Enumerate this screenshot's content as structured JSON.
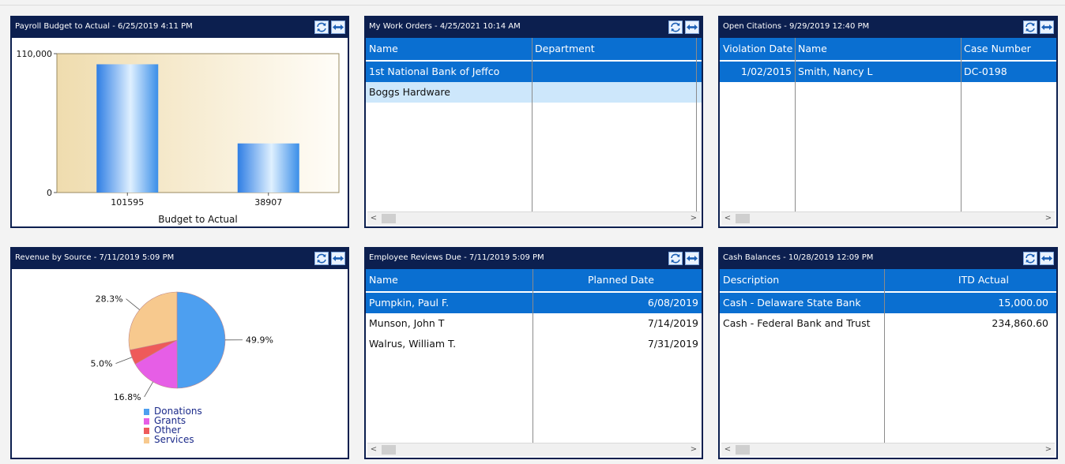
{
  "panels": {
    "payroll": {
      "title": "Payroll Budget to Actual -  6/25/2019  4:11 PM",
      "refresh_icon": "refresh-icon",
      "link_icon": "link-icon"
    },
    "workorders": {
      "title": "My Work Orders -  4/25/2021 10:14 AM",
      "columns": [
        "Name",
        "Department"
      ],
      "rows": [
        {
          "name": "1st National Bank of Jeffco",
          "department": ""
        },
        {
          "name": "Boggs Hardware",
          "department": ""
        }
      ]
    },
    "citations": {
      "title": "Open Citations -  9/29/2019 12:40 PM",
      "columns": [
        "Violation Date",
        "Name",
        "Case Number"
      ],
      "rows": [
        {
          "date": "1/02/2015",
          "name": "Smith, Nancy L",
          "case": "DC-0198"
        }
      ]
    },
    "revenue": {
      "title": "Revenue by Source -  7/11/2019  5:09 PM"
    },
    "reviews": {
      "title": "Employee Reviews Due -  7/11/2019  5:09 PM",
      "columns": [
        "Name",
        "Planned Date"
      ],
      "rows": [
        {
          "name": "Pumpkin, Paul F.",
          "date": "6/08/2019"
        },
        {
          "name": "Munson, John T",
          "date": "7/14/2019"
        },
        {
          "name": "Walrus, William T.",
          "date": "7/31/2019"
        }
      ]
    },
    "cash": {
      "title": "Cash Balances - 10/28/2019 12:09 PM",
      "columns": [
        "Description",
        "ITD Actual"
      ],
      "rows": [
        {
          "description": "Cash - Delaware State Bank",
          "amount": "15,000.00"
        },
        {
          "description": "Cash - Federal Bank and Trust",
          "amount": "234,860.60"
        }
      ]
    }
  },
  "chart_data": [
    {
      "type": "bar",
      "categories": [
        "101595",
        "38907"
      ],
      "values": [
        101595,
        38907
      ],
      "xlabel": "Budget to Actual",
      "ylabel": "",
      "ylim": [
        0,
        110000
      ],
      "ytick_labels": [
        "110,000",
        "0"
      ],
      "colors": [
        "#3a8ee8",
        "#3a8ee8"
      ]
    },
    {
      "type": "pie",
      "categories": [
        "Donations",
        "Grants",
        "Other",
        "Services"
      ],
      "values": [
        49.9,
        16.8,
        5.0,
        28.3
      ],
      "labels": [
        "49.9%",
        "16.8%",
        "5.0%",
        "28.3%"
      ],
      "colors": [
        "#4d9ff0",
        "#e65ee6",
        "#ee5a5a",
        "#f7c98e"
      ],
      "legend": "bottom"
    }
  ]
}
